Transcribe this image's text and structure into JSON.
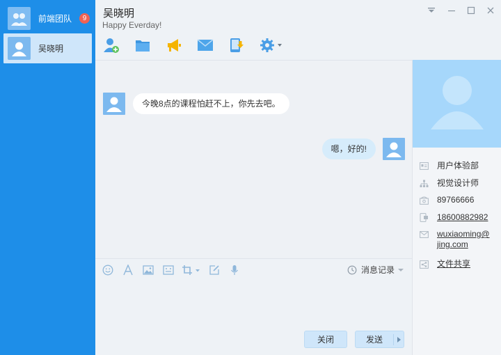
{
  "sidebar": {
    "conversations": [
      {
        "name": "前端团队",
        "badge": "9"
      },
      {
        "name": "吴晓明"
      }
    ]
  },
  "header": {
    "title": "吴晓明",
    "subtitle": "Happy Everday!"
  },
  "messages": [
    {
      "direction": "in",
      "text": "今晚8点的课程怕赶不上，你先去吧。"
    },
    {
      "direction": "out",
      "text": "嗯，好的!"
    }
  ],
  "input": {
    "history_label": "消息记录",
    "close_label": "关闭",
    "send_label": "发送"
  },
  "profile": {
    "department": "用户体验部",
    "position": "视觉设计师",
    "phone": "89766666",
    "mobile": "18600882982",
    "email_line1": "wuxiaoming@",
    "email_line2": "jing.com",
    "file_share": "文件共享"
  },
  "colors": {
    "sidebar_bg": "#1e8ee8",
    "accent": "#1e8ee8",
    "badge": "#f06254",
    "bubble_out": "#d6ecfb",
    "button_bg": "#cfe6fa"
  }
}
